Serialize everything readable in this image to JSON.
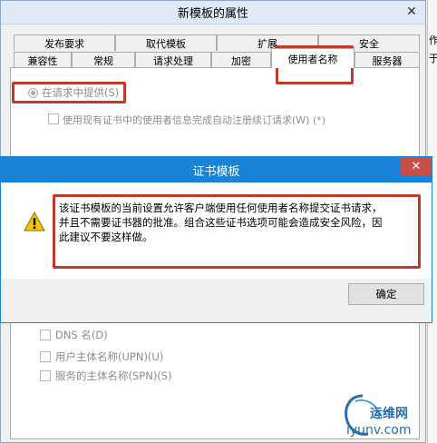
{
  "properties_dialog": {
    "title": "新模板的属性",
    "close_glyph": "✕",
    "tabs_row1": [
      "发布要求",
      "取代模板",
      "扩展",
      "安全"
    ],
    "tabs_row2": [
      "兼容性",
      "常规",
      "请求处理",
      "加密",
      "使用者名称",
      "服务器"
    ],
    "selected_tab": "使用者名称",
    "supply_radio_label": "在请求中提供(S)",
    "renew_checkbox_label": "使用现有证书中的使用者信息完成自动注册续订请求(W) (*)",
    "san_checkboxes": [
      "DNS 名(D)",
      "用户主体名称(UPN)(U)",
      "服务的主体名称(SPN)(S)"
    ]
  },
  "side_window": {
    "text_top": "作",
    "text_second": "于"
  },
  "cert_dialog": {
    "title": "证书模板",
    "close_glyph": "✕",
    "message_line1": "该证书模板的当前设置允许客户端使用任何使用者名称提交证书请求，",
    "message_line2": "并且不需要证书器的批准。组合这些证书选项可能会造成安全风险，因",
    "message_line3": "此建议不要这样做。",
    "ok_label": "确定",
    "icon": "warning-icon"
  },
  "watermark": {
    "brand_cn": "运维网",
    "brand_url": "iyunv.com"
  },
  "colors": {
    "dialog_title_blue": "#1883d7",
    "close_red": "#c74f4a",
    "highlight_red": "#c0392b",
    "watermark_blue": "#2b6cb0"
  }
}
